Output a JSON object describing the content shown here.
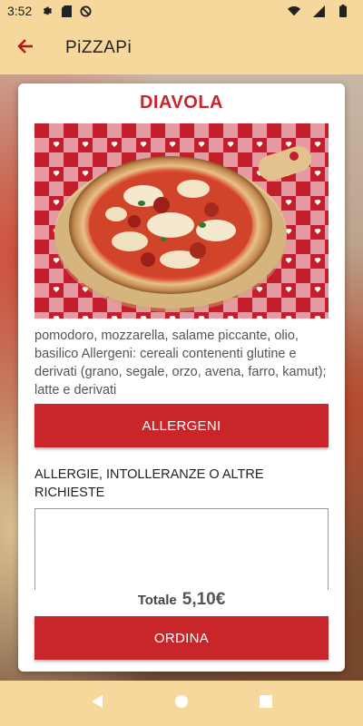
{
  "status_bar": {
    "time": "3:52",
    "left_icons": [
      "gear-icon",
      "sd-card-icon",
      "no-disturb-icon"
    ],
    "right_icons": [
      "wifi-icon",
      "signal-icon",
      "battery-icon"
    ]
  },
  "app_bar": {
    "title": "PiZZAPi",
    "back_icon": "back-arrow-icon",
    "background": "#f6d79c"
  },
  "product": {
    "name": "DIAVOLA",
    "description": "pomodoro, mozzarella, salame piccante, olio, basilico  Allergeni: cereali contenenti glutine e derivati (grano, segale, orzo, avena, farro, kamut); latte e derivati"
  },
  "buttons": {
    "allergens_label": "ALLERGENI",
    "order_label": "ORDINA"
  },
  "requests": {
    "label": "ALLERGIE, INTOLLERANZE O ALTRE RICHIESTE",
    "value": ""
  },
  "total": {
    "label": "Totale",
    "value": "5,10€"
  },
  "colors": {
    "accent": "#c8262a",
    "bar": "#f6d79c"
  }
}
